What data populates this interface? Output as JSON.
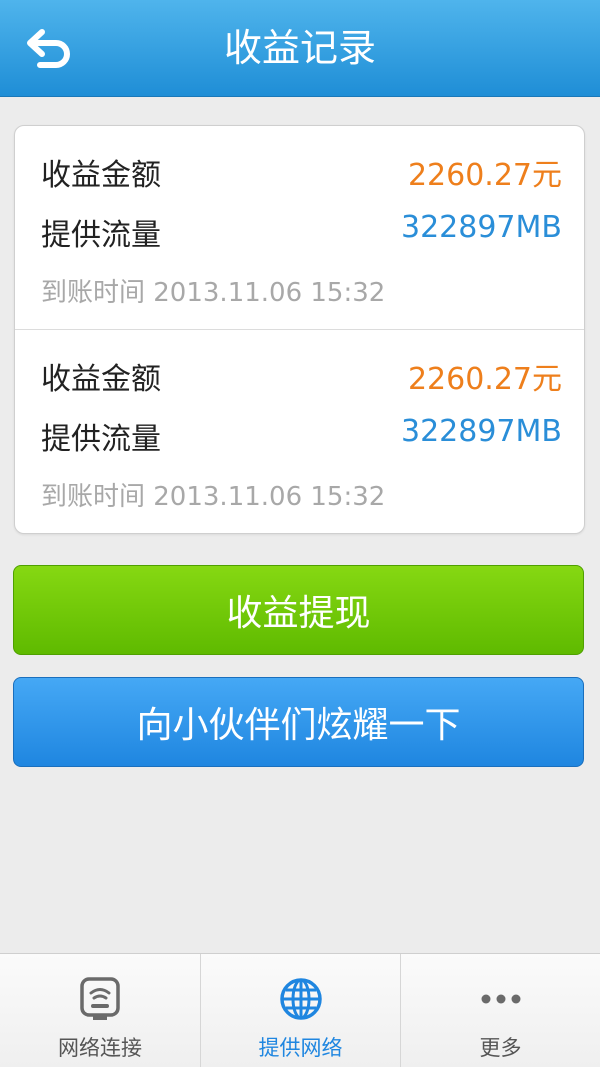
{
  "header": {
    "title": "收益记录"
  },
  "records": [
    {
      "amount_label": "收益金额",
      "amount_value": "2260.27元",
      "flow_label": "提供流量",
      "flow_value": "322897MB",
      "time": "到账时间 2013.11.06  15:32"
    },
    {
      "amount_label": "收益金额",
      "amount_value": "2260.27元",
      "flow_label": "提供流量",
      "flow_value": "322897MB",
      "time": "到账时间 2013.11.06  15:32"
    }
  ],
  "buttons": {
    "withdraw": "收益提现",
    "share": "向小伙伴们炫耀一下"
  },
  "tabs": [
    {
      "label": "网络连接",
      "icon": "wifi-router-icon"
    },
    {
      "label": "提供网络",
      "icon": "globe-icon",
      "active": true
    },
    {
      "label": "更多",
      "icon": "more-dots-icon"
    }
  ],
  "colors": {
    "header": "#1f8ed6",
    "amount": "#ee7f1c",
    "flow": "#2a8ed8",
    "withdraw_button": "#6cc40a",
    "share_button": "#2a90e6",
    "active_tab": "#1f86e0"
  }
}
